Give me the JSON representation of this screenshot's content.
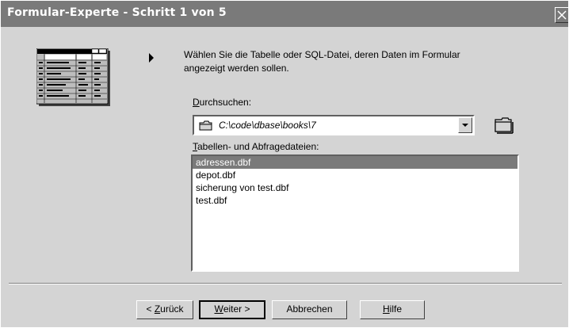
{
  "window": {
    "title": "Formular-Experte - Schritt 1 von 5"
  },
  "info_text": "Wählen Sie die Tabelle oder SQL-Datei, deren Daten im Formular angezeigt werden sollen.",
  "browse": {
    "label_mnemonic": "D",
    "label_rest": "urchsuchen:",
    "path": "C:\\code\\dbase\\books\\7"
  },
  "files": {
    "label_mnemonic": "T",
    "label_rest": "abellen- und Abfragedateien:",
    "items": [
      "adressen.dbf",
      "depot.dbf",
      "sicherung von test.dbf",
      "test.dbf"
    ],
    "selected": "adressen.dbf"
  },
  "buttons": {
    "back_prefix": "< ",
    "back_mnemonic": "Z",
    "back_rest": "urück",
    "next_mnemonic": "W",
    "next_rest": "eiter >",
    "cancel": "Abbrechen",
    "help_mnemonic": "H",
    "help_rest": "ilfe"
  },
  "icons": {
    "close": "close-icon",
    "table_preview": "table-preview-icon",
    "pointer": "triangle-right-icon",
    "path_folder": "folder-icon",
    "browse_folder": "folder-browse-icon"
  },
  "colors": {
    "titlebar": "#7a7a7a",
    "selection": "#7a7a7a",
    "face": "#d4d4d4"
  }
}
